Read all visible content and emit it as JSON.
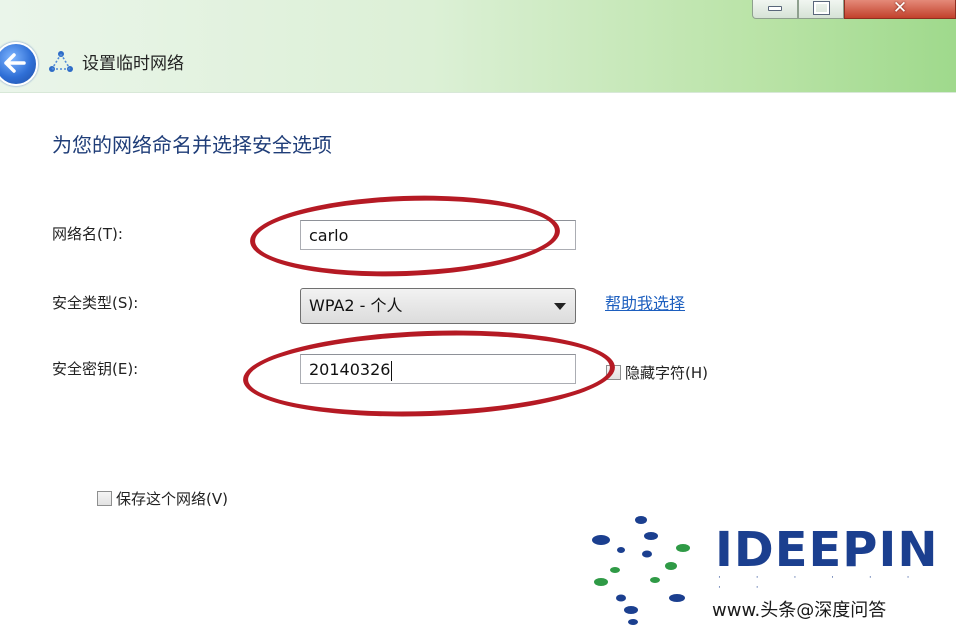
{
  "window": {
    "title": "设置临时网络",
    "close_glyph": "✕"
  },
  "heading": "为您的网络命名并选择安全选项",
  "fields": {
    "network_name_label": "网络名(T):",
    "network_name_value": "carlo",
    "security_type_label": "安全类型(S):",
    "security_type_value": "WPA2 - 个人",
    "security_key_label": "安全密钥(E):",
    "security_key_value": "20140326"
  },
  "help_link": "帮助我选择",
  "hide_chars_label": "隐藏字符(H)",
  "save_network_label": "保存这个网络(V)",
  "watermark": {
    "brand": "IDEEPIN",
    "dots": "·  ·  ·  ·  ·  ·  ·  ·",
    "caption": "www.头条@深度问答"
  },
  "colors": {
    "heading": "#1f3d78",
    "annotation_ring": "#b51a24",
    "link": "#1d5fbf",
    "brand": "#1b3f8f"
  }
}
